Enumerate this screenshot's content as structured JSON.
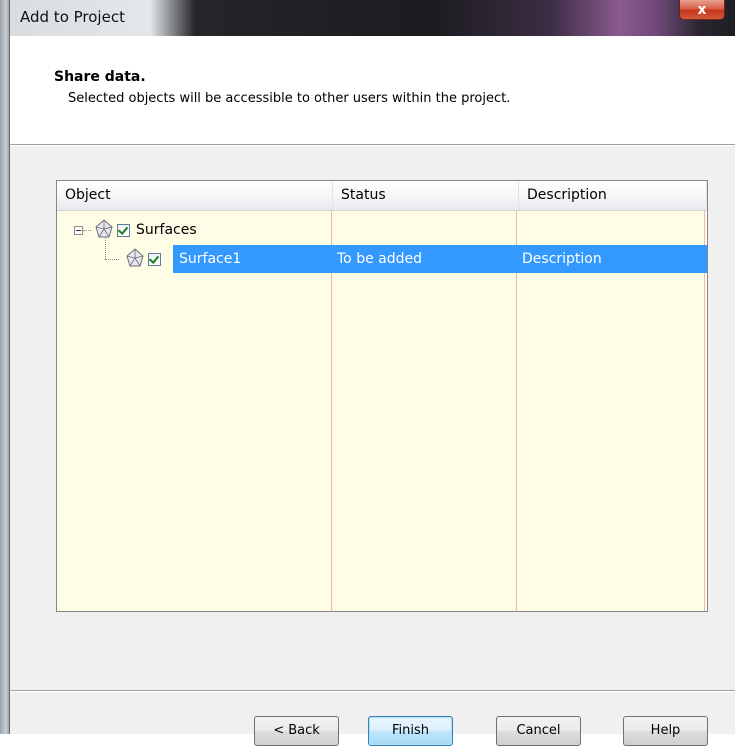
{
  "window": {
    "title": "Add to Project",
    "close_glyph": "x"
  },
  "header": {
    "title": "Share data.",
    "subtitle": "Selected objects will be accessible to other users within the project."
  },
  "table": {
    "columns": [
      "Object",
      "Status",
      "Description"
    ],
    "rows": [
      {
        "object": "Surfaces",
        "status": "",
        "description": "",
        "checked": true,
        "expanded": true,
        "icon": "surface-tin-icon",
        "level": 0,
        "selected": false
      },
      {
        "object": "Surface1",
        "status": "To be added",
        "description": "Description",
        "checked": true,
        "icon": "surface-tin-icon",
        "level": 1,
        "selected": true
      }
    ]
  },
  "buttons": {
    "back": "< Back",
    "finish": "Finish",
    "cancel": "Cancel",
    "help": "Help"
  },
  "colors": {
    "list_background": "#fffde6",
    "selection": "#3399ff",
    "gridline": "#f2b5b5",
    "close_button": "#c4351d"
  }
}
